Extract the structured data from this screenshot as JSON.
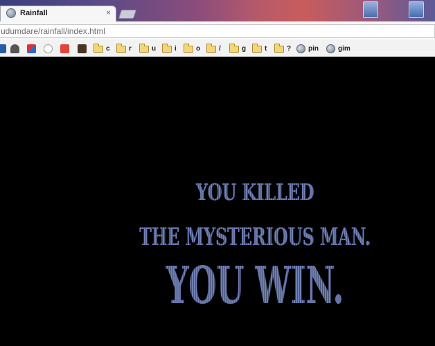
{
  "browser": {
    "tab": {
      "title": "Rainfall",
      "close_glyph": "×"
    },
    "address_bar": {
      "url": "udumdare/rainfall/index.html"
    },
    "bookmarks": [
      {
        "icon": "app-icon-1",
        "label": ""
      },
      {
        "icon": "headphones-icon",
        "label": ""
      },
      {
        "icon": "app-icon-2",
        "label": ""
      },
      {
        "icon": "reddit-icon",
        "label": ""
      },
      {
        "icon": "app-icon-3",
        "label": ""
      },
      {
        "icon": "app-icon-4",
        "label": ""
      },
      {
        "icon": "folder-icon",
        "label": "c"
      },
      {
        "icon": "folder-icon",
        "label": "r"
      },
      {
        "icon": "folder-icon",
        "label": "u"
      },
      {
        "icon": "folder-icon",
        "label": "i"
      },
      {
        "icon": "folder-icon",
        "label": "o"
      },
      {
        "icon": "folder-icon",
        "label": "/"
      },
      {
        "icon": "folder-icon",
        "label": "g"
      },
      {
        "icon": "folder-icon",
        "label": "t"
      },
      {
        "icon": "folder-icon",
        "label": "?"
      },
      {
        "icon": "globe-icon",
        "label": "pin"
      },
      {
        "icon": "globe-icon",
        "label": "gim"
      }
    ]
  },
  "game": {
    "message_line1": "YOU KILLED",
    "message_line2": "THE MYSTERIOUS MAN.",
    "message_line3": "YOU WIN."
  },
  "colors": {
    "page_background": "#000000",
    "text": "#6f7fb3"
  }
}
